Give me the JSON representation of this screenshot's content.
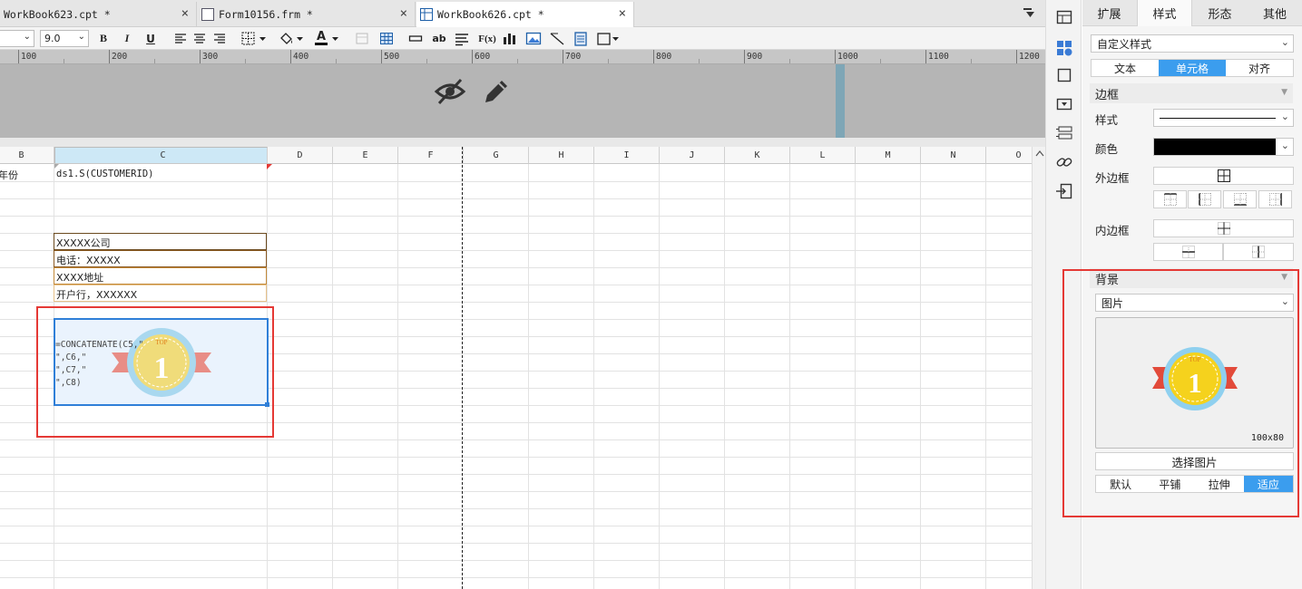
{
  "tabs": [
    {
      "label": "WorkBook623.cpt *",
      "close": "×"
    },
    {
      "label": "Form10156.frm *",
      "close": "×"
    },
    {
      "label": "WorkBook626.cpt *",
      "close": "×"
    }
  ],
  "toolbar": {
    "font_size": "9.0",
    "bold": "B",
    "italic": "I",
    "underline": "U",
    "text_color": "A",
    "ab": "ab",
    "fx": "F(x)"
  },
  "ruler": {
    "ticks": [
      "100",
      "200",
      "300",
      "400",
      "500",
      "600",
      "700",
      "800",
      "900",
      "1000",
      "1100",
      "1200"
    ]
  },
  "grid": {
    "columns": [
      "B",
      "C",
      "D",
      "E",
      "F",
      "G",
      "H",
      "I",
      "J",
      "K",
      "L",
      "M",
      "N",
      "O"
    ],
    "cells": {
      "b2": "年份",
      "c2": "ds1.S(CUSTOMERID)",
      "c5": "XXXXX公司",
      "c6": "电话：XXXXX",
      "c7": "XXXX地址",
      "c8": "开户行，XXXXXX",
      "formula_lines": [
        "=CONCATENATE(C5,\"",
        "\",C6,\"",
        "\",C7,\"",
        "\",C8)"
      ]
    },
    "badge_text": {
      "top": "TOP",
      "num": "1"
    }
  },
  "panel": {
    "tabs": [
      "扩展",
      "样式",
      "形态",
      "其他"
    ],
    "active_tab": "样式",
    "style_select": "自定义样式",
    "subtabs": [
      "文本",
      "单元格",
      "对齐"
    ],
    "active_subtab": "单元格",
    "border_section": "边框",
    "style_label": "样式",
    "color_label": "颜色",
    "outer_label": "外边框",
    "inner_label": "内边框",
    "bg_section": "背景",
    "bg_type": "图片",
    "preview_size": "100x80",
    "choose_image": "选择图片",
    "fit_modes": [
      "默认",
      "平铺",
      "拉伸",
      "适应"
    ],
    "active_fit": "适应"
  },
  "colors": {
    "accent": "#3b9dee",
    "highlight": "#e53935"
  }
}
